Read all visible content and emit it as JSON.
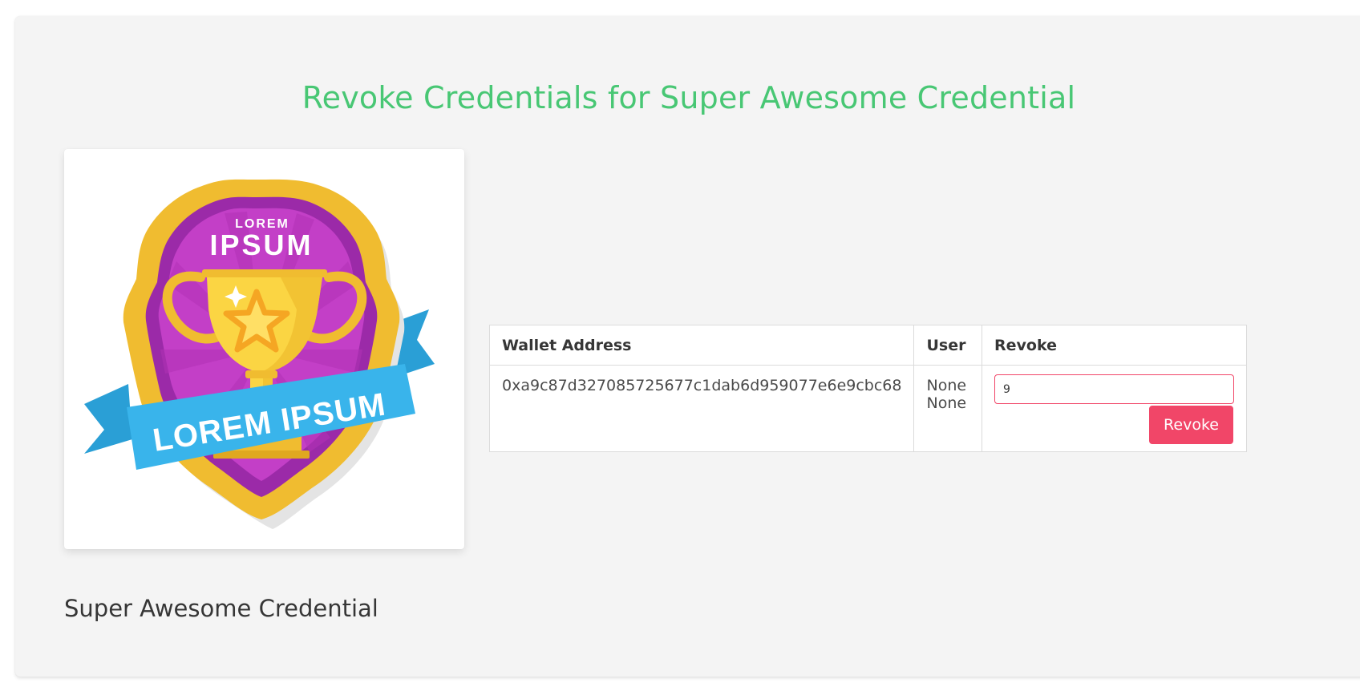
{
  "page": {
    "title": "Revoke Credentials for Super Awesome Credential"
  },
  "credential": {
    "name": "Super Awesome Credential",
    "image_alt": "Credential badge",
    "badge_text_top_small": "LOREM",
    "badge_text_top_large": "IPSUM",
    "badge_ribbon_text": "LOREM IPSUM"
  },
  "table": {
    "headers": [
      "Wallet Address",
      "User",
      "Revoke"
    ],
    "rows": [
      {
        "wallet_address": "0xa9c87d327085725677c1dab6d959077e6e9cbc68",
        "user": "None None",
        "revoke_input_value": "9",
        "revoke_button_label": "Revoke"
      }
    ]
  },
  "colors": {
    "title_accent": "#48c774",
    "danger": "#f14668",
    "card_background": "#f4f4f4"
  }
}
